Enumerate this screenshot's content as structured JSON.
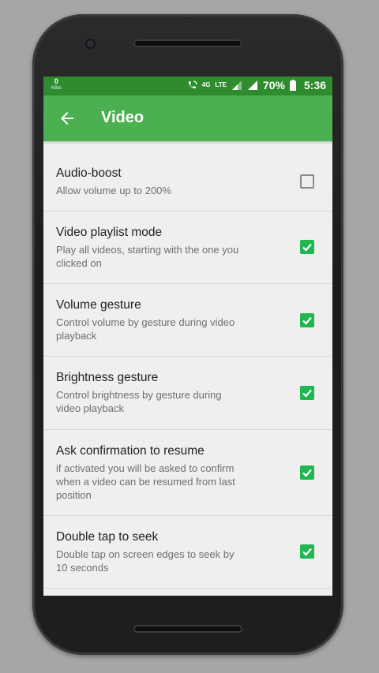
{
  "status_bar": {
    "speed_value": "0",
    "speed_unit": "KB/s",
    "network_4g": "4G",
    "network_lte": "LTE",
    "battery": "70%",
    "time": "5:36"
  },
  "toolbar": {
    "title": "Video"
  },
  "settings": [
    {
      "title": "Audio-boost",
      "subtitle": "Allow volume up to 200%",
      "checked": false
    },
    {
      "title": "Video playlist mode",
      "subtitle": "Play all videos, starting with the one you clicked on",
      "checked": true
    },
    {
      "title": "Volume gesture",
      "subtitle": "Control volume by gesture during video playback",
      "checked": true
    },
    {
      "title": "Brightness gesture",
      "subtitle": "Control brightness by gesture during video playback",
      "checked": true
    },
    {
      "title": "Ask confirmation to resume",
      "subtitle": "if activated you will be asked to confirm when a video can be resumed from last position",
      "checked": true
    },
    {
      "title": "Double tap to seek",
      "subtitle": "Double tap on screen edges to seek by 10 seconds",
      "checked": true
    }
  ],
  "colors": {
    "appbar": "#4caf50",
    "statusbar": "#2e8b2e",
    "checkbox_on": "#20b650"
  }
}
